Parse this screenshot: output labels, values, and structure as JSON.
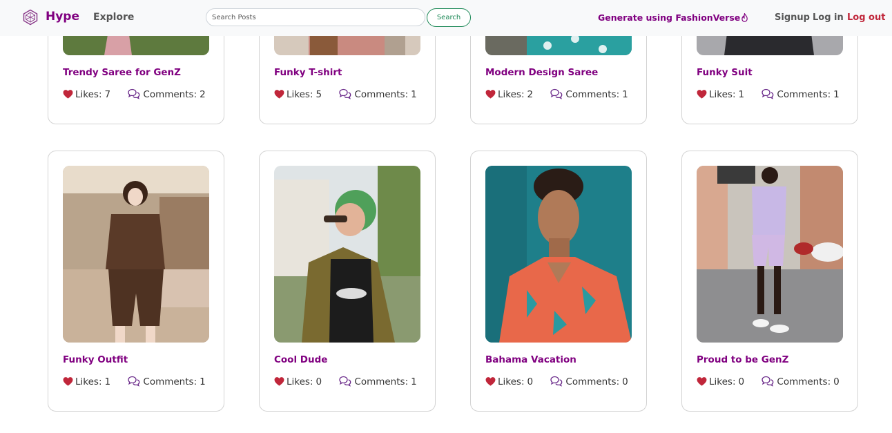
{
  "nav": {
    "brand": "Hype",
    "explore": "Explore",
    "search_placeholder": "Search Posts",
    "search_button": "Search",
    "generate": "Generate using FashionVerse",
    "signup": "Signup",
    "login": "Log in",
    "logout": "Log out"
  },
  "labels": {
    "likes": "Likes:",
    "comments": "Comments:"
  },
  "colors": {
    "brand": "#800080",
    "heart": "#c0263a",
    "search_green": "#198754"
  },
  "posts": [
    {
      "title": "Trendy Saree for GenZ",
      "likes": 7,
      "comments": 2
    },
    {
      "title": "Funky T-shirt",
      "likes": 5,
      "comments": 1
    },
    {
      "title": "Modern Design Saree",
      "likes": 2,
      "comments": 1
    },
    {
      "title": "Funky Suit",
      "likes": 1,
      "comments": 1
    },
    {
      "title": "Funky Outfit",
      "likes": 1,
      "comments": 1
    },
    {
      "title": "Cool Dude",
      "likes": 0,
      "comments": 1
    },
    {
      "title": "Bahama Vacation",
      "likes": 0,
      "comments": 0
    },
    {
      "title": "Proud to be GenZ",
      "likes": 0,
      "comments": 0
    }
  ]
}
